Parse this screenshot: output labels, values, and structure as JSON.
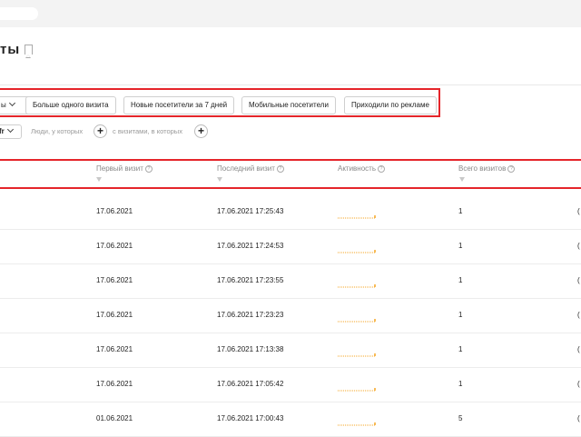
{
  "header": {
    "title": "ты"
  },
  "segments": {
    "dropdown_label": "ы",
    "chips": [
      "Больше одного визита",
      "Новые посетители за 7 дней",
      "Мобильные посетители",
      "Приходили по рекламе"
    ]
  },
  "filters": {
    "dropdown_label": "fr",
    "people_label": "Люди, у которых",
    "visits_label": "с визитами, в которых"
  },
  "table": {
    "columns": [
      "Первый визит",
      "Последний визит",
      "Активность",
      "Всего визитов"
    ],
    "rows": [
      {
        "first_visit": "17.06.2021",
        "last_visit": "17.06.2021 17:25:43",
        "total_visits": "1",
        "edge": "("
      },
      {
        "first_visit": "17.06.2021",
        "last_visit": "17.06.2021 17:24:53",
        "total_visits": "1",
        "edge": "("
      },
      {
        "first_visit": "17.06.2021",
        "last_visit": "17.06.2021 17:23:55",
        "total_visits": "1",
        "edge": "("
      },
      {
        "first_visit": "17.06.2021",
        "last_visit": "17.06.2021 17:23:23",
        "total_visits": "1",
        "edge": "("
      },
      {
        "first_visit": "17.06.2021",
        "last_visit": "17.06.2021 17:13:38",
        "total_visits": "1",
        "edge": "("
      },
      {
        "first_visit": "17.06.2021",
        "last_visit": "17.06.2021 17:05:42",
        "total_visits": "1",
        "edge": "("
      },
      {
        "first_visit": "01.06.2021",
        "last_visit": "17.06.2021 17:00:43",
        "total_visits": "5",
        "edge": "("
      }
    ]
  },
  "colors": {
    "highlight": "#e5252a",
    "activity": "#f5a623"
  },
  "icons": [
    "bookmark-icon",
    "chevron-down-icon",
    "plus-icon",
    "info-icon",
    "filter-icon"
  ]
}
